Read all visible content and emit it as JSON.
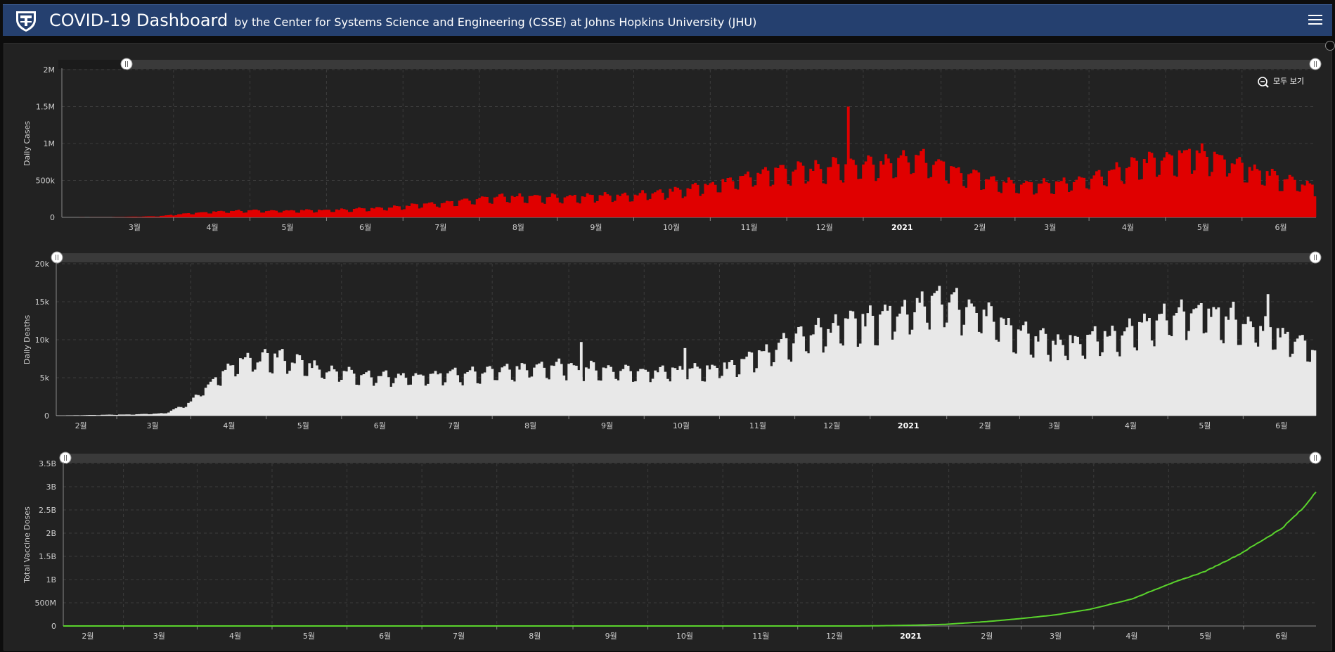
{
  "header": {
    "title": "COVID-19 Dashboard",
    "subtitle": "by the Center for Systems Science and Engineering (CSSE) at Johns Hopkins University (JHU)",
    "menu_icon": "hamburger-menu-icon",
    "logo_icon": "jhu-shield-logo"
  },
  "zoom_button": {
    "label": "모두 보기",
    "icon": "zoom-out-icon"
  },
  "colors": {
    "header_bg": "#25406f",
    "panel_bg": "#222222",
    "cases": "#e00000",
    "deaths": "#e8e8e8",
    "vaccines": "#5ad42c"
  },
  "chart_data": [
    {
      "type": "bar",
      "ylabel": "Daily Cases",
      "ylim": [
        0,
        2000000
      ],
      "yticks": [
        "0",
        "500k",
        "1M",
        "1.5M",
        "2M"
      ],
      "xlabels": [
        "3월",
        "4월",
        "5월",
        "6월",
        "7월",
        "8월",
        "9월",
        "10월",
        "11월",
        "12월",
        "2021",
        "2월",
        "3월",
        "4월",
        "5월",
        "6월"
      ],
      "x_range": [
        "2020-02-01",
        "2021-06-15"
      ],
      "keypoints": [
        [
          "2020-02-01",
          0
        ],
        [
          "2020-02-20",
          1500
        ],
        [
          "2020-03-10",
          15000
        ],
        [
          "2020-03-25",
          60000
        ],
        [
          "2020-04-10",
          85000
        ],
        [
          "2020-05-01",
          85000
        ],
        [
          "2020-05-20",
          95000
        ],
        [
          "2020-06-10",
          130000
        ],
        [
          "2020-07-01",
          190000
        ],
        [
          "2020-07-25",
          260000
        ],
        [
          "2020-08-15",
          260000
        ],
        [
          "2020-09-15",
          290000
        ],
        [
          "2020-10-10",
          380000
        ],
        [
          "2020-10-25",
          480000
        ],
        [
          "2020-11-10",
          600000
        ],
        [
          "2020-11-25",
          620000
        ],
        [
          "2020-12-10",
          680000
        ],
        [
          "2020-12-25",
          720000
        ],
        [
          "2021-01-08",
          760000
        ],
        [
          "2021-01-25",
          580000
        ],
        [
          "2021-02-15",
          420000
        ],
        [
          "2021-03-05",
          440000
        ],
        [
          "2021-03-25",
          580000
        ],
        [
          "2021-04-10",
          740000
        ],
        [
          "2021-04-28",
          830000
        ],
        [
          "2021-05-10",
          760000
        ],
        [
          "2021-05-25",
          560000
        ],
        [
          "2021-06-15",
          380000
        ]
      ],
      "weekly_amplitude": 0.28,
      "spike": {
        "date": "2020-12-10",
        "value": 1500000
      },
      "color": "#e00000"
    },
    {
      "type": "bar",
      "ylabel": "Daily Deaths",
      "ylim": [
        0,
        20000
      ],
      "yticks": [
        "0",
        "5k",
        "10k",
        "15k",
        "20k"
      ],
      "xlabels": [
        "2월",
        "3월",
        "4월",
        "5월",
        "6월",
        "7월",
        "8월",
        "9월",
        "10월",
        "11월",
        "12월",
        "2021",
        "2월",
        "3월",
        "4월",
        "5월",
        "6월"
      ],
      "x_range": [
        "2020-01-22",
        "2021-06-15"
      ],
      "keypoints": [
        [
          "2020-01-22",
          20
        ],
        [
          "2020-02-20",
          150
        ],
        [
          "2020-03-05",
          300
        ],
        [
          "2020-03-15",
          1500
        ],
        [
          "2020-03-25",
          4500
        ],
        [
          "2020-04-05",
          6800
        ],
        [
          "2020-04-20",
          7500
        ],
        [
          "2020-05-10",
          5800
        ],
        [
          "2020-06-01",
          5000
        ],
        [
          "2020-06-20",
          5000
        ],
        [
          "2020-07-15",
          5600
        ],
        [
          "2020-08-10",
          6300
        ],
        [
          "2020-09-05",
          5800
        ],
        [
          "2020-10-01",
          5600
        ],
        [
          "2020-10-20",
          6300
        ],
        [
          "2020-11-05",
          8300
        ],
        [
          "2020-11-25",
          10800
        ],
        [
          "2020-12-15",
          12000
        ],
        [
          "2021-01-10",
          14500
        ],
        [
          "2021-01-25",
          14000
        ],
        [
          "2021-02-10",
          11000
        ],
        [
          "2021-03-01",
          9300
        ],
        [
          "2021-03-25",
          10000
        ],
        [
          "2021-04-10",
          12000
        ],
        [
          "2021-04-28",
          13500
        ],
        [
          "2021-05-15",
          12200
        ],
        [
          "2021-06-01",
          10000
        ],
        [
          "2021-06-15",
          8500
        ]
      ],
      "weekly_amplitude": 0.22,
      "spikes": [
        {
          "date": "2020-08-21",
          "value": 9700
        },
        {
          "date": "2020-10-02",
          "value": 8900
        },
        {
          "date": "2021-05-26",
          "value": 16000
        }
      ],
      "color": "#e8e8e8"
    },
    {
      "type": "line",
      "ylabel": "Total Vaccine Doses",
      "ylim": [
        0,
        3500000000
      ],
      "yticks": [
        "0",
        "500M",
        "1B",
        "1.5B",
        "2B",
        "2.5B",
        "3B",
        "3.5B"
      ],
      "xlabels": [
        "2월",
        "3월",
        "4월",
        "5월",
        "6월",
        "7월",
        "8월",
        "9월",
        "10월",
        "11월",
        "12월",
        "2021",
        "2월",
        "3월",
        "4월",
        "5월",
        "6월"
      ],
      "x_range": [
        "2020-01-22",
        "2021-06-15"
      ],
      "points": [
        [
          "2020-01-22",
          0
        ],
        [
          "2020-12-10",
          0
        ],
        [
          "2020-12-20",
          5000000
        ],
        [
          "2021-01-01",
          15000000
        ],
        [
          "2021-01-15",
          35000000
        ],
        [
          "2021-02-01",
          95000000
        ],
        [
          "2021-02-15",
          160000000
        ],
        [
          "2021-03-01",
          240000000
        ],
        [
          "2021-03-15",
          360000000
        ],
        [
          "2021-04-01",
          580000000
        ],
        [
          "2021-04-15",
          880000000
        ],
        [
          "2021-05-01",
          1180000000
        ],
        [
          "2021-05-15",
          1550000000
        ],
        [
          "2021-06-01",
          2100000000
        ],
        [
          "2021-06-10",
          2550000000
        ],
        [
          "2021-06-15",
          2900000000
        ]
      ],
      "color": "#5ad42c"
    }
  ]
}
